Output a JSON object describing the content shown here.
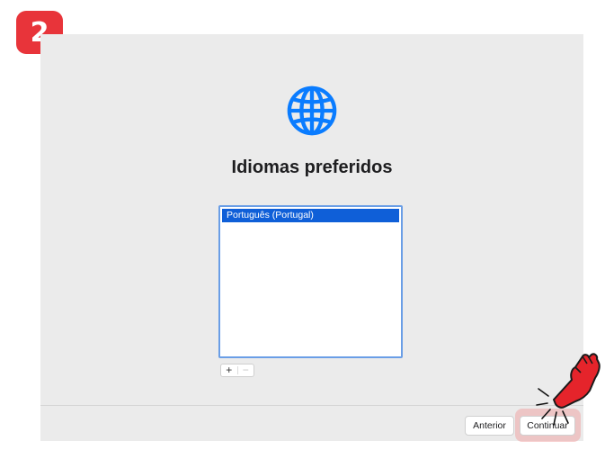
{
  "step_badge": "2",
  "window": {
    "title": "Idiomas preferidos",
    "language_list": [
      {
        "label": "Português (Portugal)",
        "selected": true
      }
    ],
    "controls": {
      "add": "+",
      "remove": "−"
    },
    "footer": {
      "back_label": "Anterior",
      "continue_label": "Continuar"
    }
  },
  "icons": {
    "globe": "globe-icon",
    "pointer": "pointing-hand-icon"
  },
  "colors": {
    "badge": "#e8343a",
    "accent": "#0f5fd8",
    "globe": "#0a7cff",
    "hand": "#e5242b"
  }
}
